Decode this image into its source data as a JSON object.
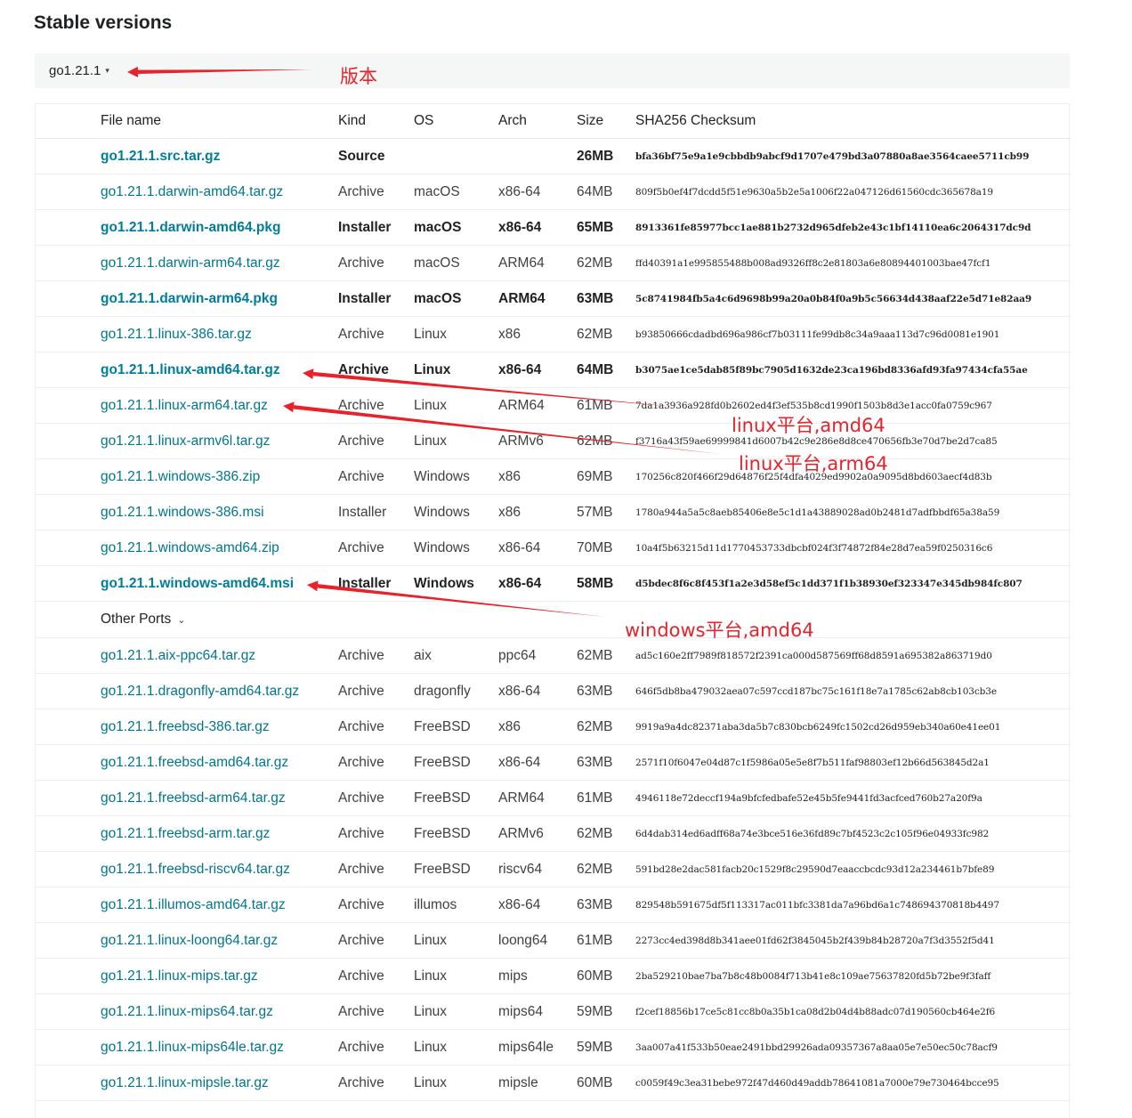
{
  "page": {
    "title": "Stable versions"
  },
  "version_selector": {
    "label": "go1.21.1",
    "caret": "▾"
  },
  "table": {
    "headers": {
      "file_name": "File name",
      "kind": "Kind",
      "os": "OS",
      "arch": "Arch",
      "size": "Size",
      "sha": "SHA256 Checksum"
    },
    "featured_rows": [
      {
        "file": "go1.21.1.src.tar.gz",
        "kind": "Source",
        "os": "",
        "arch": "",
        "size": "26MB",
        "sha": "bfa36bf75e9a1e9cbbdb9abcf9d1707e479bd3a07880a8ae3564caee5711cb99",
        "highlight": true
      },
      {
        "file": "go1.21.1.darwin-amd64.tar.gz",
        "kind": "Archive",
        "os": "macOS",
        "arch": "x86-64",
        "size": "64MB",
        "sha": "809f5b0ef4f7dcdd5f51e9630a5b2e5a1006f22a047126d61560cdc365678a19",
        "highlight": false
      },
      {
        "file": "go1.21.1.darwin-amd64.pkg",
        "kind": "Installer",
        "os": "macOS",
        "arch": "x86-64",
        "size": "65MB",
        "sha": "8913361fe85977bcc1ae881b2732d965dfeb2e43c1bf14110ea6c2064317dc9d",
        "highlight": true
      },
      {
        "file": "go1.21.1.darwin-arm64.tar.gz",
        "kind": "Archive",
        "os": "macOS",
        "arch": "ARM64",
        "size": "62MB",
        "sha": "ffd40391a1e995855488b008ad9326ff8c2e81803a6e80894401003bae47fcf1",
        "highlight": false
      },
      {
        "file": "go1.21.1.darwin-arm64.pkg",
        "kind": "Installer",
        "os": "macOS",
        "arch": "ARM64",
        "size": "63MB",
        "sha": "5c8741984fb5a4c6d9698b99a20a0b84f0a9b5c56634d438aaf22e5d71e82aa9",
        "highlight": true
      },
      {
        "file": "go1.21.1.linux-386.tar.gz",
        "kind": "Archive",
        "os": "Linux",
        "arch": "x86",
        "size": "62MB",
        "sha": "b93850666cdadbd696a986cf7b03111fe99db8c34a9aaa113d7c96d0081e1901",
        "highlight": false
      },
      {
        "file": "go1.21.1.linux-amd64.tar.gz",
        "kind": "Archive",
        "os": "Linux",
        "arch": "x86-64",
        "size": "64MB",
        "sha": "b3075ae1ce5dab85f89bc7905d1632de23ca196bd8336afd93fa97434cfa55ae",
        "highlight": true
      },
      {
        "file": "go1.21.1.linux-arm64.tar.gz",
        "kind": "Archive",
        "os": "Linux",
        "arch": "ARM64",
        "size": "61MB",
        "sha": "7da1a3936a928fd0b2602ed4f3ef535b8cd1990f1503b8d3e1acc0fa0759c967",
        "highlight": false
      },
      {
        "file": "go1.21.1.linux-armv6l.tar.gz",
        "kind": "Archive",
        "os": "Linux",
        "arch": "ARMv6",
        "size": "62MB",
        "sha": "f3716a43f59ae69999841d6007b42c9e286e8d8ce470656fb3e70d7be2d7ca85",
        "highlight": false
      },
      {
        "file": "go1.21.1.windows-386.zip",
        "kind": "Archive",
        "os": "Windows",
        "arch": "x86",
        "size": "69MB",
        "sha": "170256c820f466f29d64876f25f4dfa4029ed9902a0a9095d8bd603aecf4d83b",
        "highlight": false
      },
      {
        "file": "go1.21.1.windows-386.msi",
        "kind": "Installer",
        "os": "Windows",
        "arch": "x86",
        "size": "57MB",
        "sha": "1780a944a5a5c8aeb85406e8e5c1d1a43889028ad0b2481d7adfbbdf65a38a59",
        "highlight": false
      },
      {
        "file": "go1.21.1.windows-amd64.zip",
        "kind": "Archive",
        "os": "Windows",
        "arch": "x86-64",
        "size": "70MB",
        "sha": "10a4f5b63215d11d1770453733dbcbf024f3f74872f84e28d7ea59f0250316c6",
        "highlight": false
      },
      {
        "file": "go1.21.1.windows-amd64.msi",
        "kind": "Installer",
        "os": "Windows",
        "arch": "x86-64",
        "size": "58MB",
        "sha": "d5bdec8f6c8f453f1a2e3d58ef5c1dd371f1b38930ef323347e345db984fc807",
        "highlight": true
      }
    ],
    "other_ports_label": "Other Ports",
    "other_ports_chevron": "⌄",
    "other_rows": [
      {
        "file": "go1.21.1.aix-ppc64.tar.gz",
        "kind": "Archive",
        "os": "aix",
        "arch": "ppc64",
        "size": "62MB",
        "sha": "ad5c160e2ff7989f818572f2391ca000d587569ff68d8591a695382a863719d0"
      },
      {
        "file": "go1.21.1.dragonfly-amd64.tar.gz",
        "kind": "Archive",
        "os": "dragonfly",
        "arch": "x86-64",
        "size": "63MB",
        "sha": "646f5db8ba479032aea07c597ccd187bc75c161f18e7a1785c62ab8cb103cb3e"
      },
      {
        "file": "go1.21.1.freebsd-386.tar.gz",
        "kind": "Archive",
        "os": "FreeBSD",
        "arch": "x86",
        "size": "62MB",
        "sha": "9919a9a4dc82371aba3da5b7c830bcb6249fc1502cd26d959eb340a60e41ee01"
      },
      {
        "file": "go1.21.1.freebsd-amd64.tar.gz",
        "kind": "Archive",
        "os": "FreeBSD",
        "arch": "x86-64",
        "size": "63MB",
        "sha": "2571f10f6047e04d87c1f5986a05e5e8f7b511faf98803ef12b66d563845d2a1"
      },
      {
        "file": "go1.21.1.freebsd-arm64.tar.gz",
        "kind": "Archive",
        "os": "FreeBSD",
        "arch": "ARM64",
        "size": "61MB",
        "sha": "4946118e72deccf194a9bfcfedbafe52e45b5fe9441fd3acfced760b27a20f9a"
      },
      {
        "file": "go1.21.1.freebsd-arm.tar.gz",
        "kind": "Archive",
        "os": "FreeBSD",
        "arch": "ARMv6",
        "size": "62MB",
        "sha": "6d4dab314ed6adff68a74e3bce516e36fd89c7bf4523c2c105f96e04933fc982"
      },
      {
        "file": "go1.21.1.freebsd-riscv64.tar.gz",
        "kind": "Archive",
        "os": "FreeBSD",
        "arch": "riscv64",
        "size": "62MB",
        "sha": "591bd28e2dac581facb20c1529f8c29590d7eaaccbcdc93d12a234461b7bfe89"
      },
      {
        "file": "go1.21.1.illumos-amd64.tar.gz",
        "kind": "Archive",
        "os": "illumos",
        "arch": "x86-64",
        "size": "63MB",
        "sha": "829548b591675df5f113317ac011bfc3381da7a96bd6a1c748694370818b4497"
      },
      {
        "file": "go1.21.1.linux-loong64.tar.gz",
        "kind": "Archive",
        "os": "Linux",
        "arch": "loong64",
        "size": "61MB",
        "sha": "2273cc4ed398d8b341aee01fd62f3845045b2f439b84b28720a7f3d3552f5d41"
      },
      {
        "file": "go1.21.1.linux-mips.tar.gz",
        "kind": "Archive",
        "os": "Linux",
        "arch": "mips",
        "size": "60MB",
        "sha": "2ba529210bae7ba7b8c48b0084f713b41e8c109ae75637820fd5b72be9f3faff"
      },
      {
        "file": "go1.21.1.linux-mips64.tar.gz",
        "kind": "Archive",
        "os": "Linux",
        "arch": "mips64",
        "size": "59MB",
        "sha": "f2cef18856b17ce5c81cc8b0a35b1ca08d2b04d4b88adc07d190560cb464e2f6"
      },
      {
        "file": "go1.21.1.linux-mips64le.tar.gz",
        "kind": "Archive",
        "os": "Linux",
        "arch": "mips64le",
        "size": "59MB",
        "sha": "3aa007a41f533b50eae2491bbd29926ada09357367a8aa05e7e50ec50c78acf9"
      },
      {
        "file": "go1.21.1.linux-mipsle.tar.gz",
        "kind": "Archive",
        "os": "Linux",
        "arch": "mipsle",
        "size": "60MB",
        "sha": "c0059f49c3ea31bebe972f47d460d49addb78641081a7000e79e730464bcce95"
      }
    ]
  },
  "annotations": {
    "version_note": "版本",
    "linux_amd64_note": "linux平台,amd64",
    "linux_arm64_note": "linux平台,arm64",
    "windows_amd64_note": "windows平台,amd64",
    "color": "#e8222a"
  },
  "colors": {
    "link": "#00758f",
    "text": "#202224",
    "bar": "#f5f6f6",
    "accent_red": "#e8222a"
  }
}
